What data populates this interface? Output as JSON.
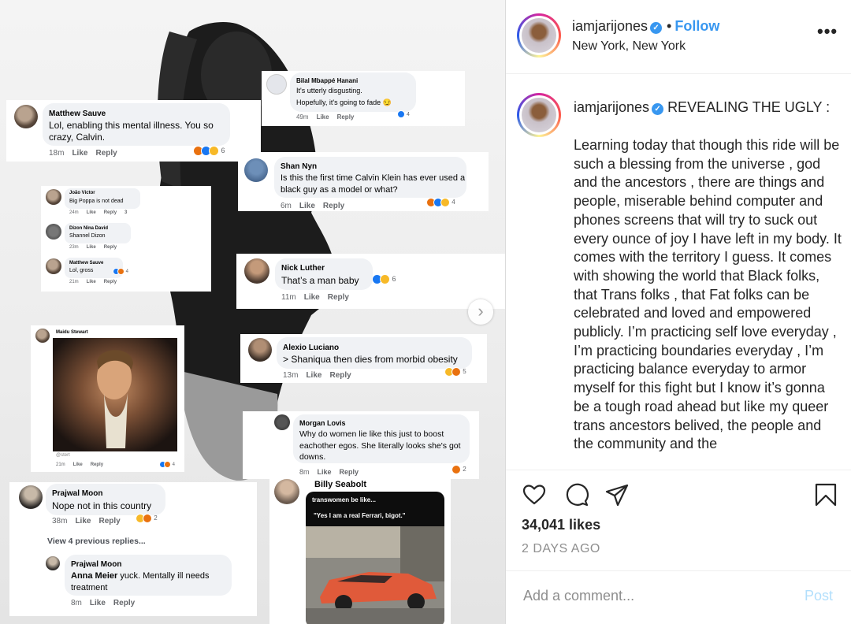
{
  "header": {
    "username": "iamjarijones",
    "follow_label": "Follow",
    "location": "New York, New York",
    "more_label": "•••"
  },
  "caption": {
    "username": "iamjarijones",
    "headline": "REVEALING THE UGLY :",
    "body": "Learning today that though this ride will be such a blessing from the universe , god and the ancestors , there are things and people, miserable behind computer and phones screens that will try to suck out every ounce of joy I have left in my body. It comes with the territory I guess. It comes with showing the world that Black folks, that Trans folks , that Fat folks can be celebrated and loved and empowered publicly. I’m practicing self love everyday , I’m practicing boundaries everyday , I’m practicing balance everyday to armor myself for this fight but I know it’s gonna be a tough road ahead but like my queer trans ancestors belived, the people and the community and the"
  },
  "engagement": {
    "likes": "34,041 likes",
    "time_ago": "2 DAYS AGO"
  },
  "comment_box": {
    "placeholder": "Add a comment...",
    "post_label": "Post"
  },
  "media": {
    "next_label": "›",
    "comments": {
      "bilal": {
        "name": "Bilal Mbappé Hanani",
        "line1": "It's utterly disgusting.",
        "line2": "Hopefully, it's going to fade 😏",
        "time": "49m",
        "like": "Like",
        "reply": "Reply",
        "count": "4"
      },
      "matthew": {
        "name": "Matthew Sauve",
        "text": "Lol, enabling this mental illness. You so crazy, Calvin.",
        "time": "18m",
        "like": "Like",
        "reply": "Reply",
        "count": "6"
      },
      "shan": {
        "name": "Shan Nyn",
        "text": "Is this the first time Calvin Klein has ever used a black guy as a model or what?",
        "time": "6m",
        "like": "Like",
        "reply": "Reply",
        "count": "4"
      },
      "joao": {
        "name": "João Victor",
        "text": "Big Poppa is not dead",
        "time": "24m",
        "like": "Like",
        "reply": "Reply",
        "count": "3"
      },
      "dizon": {
        "name": "Dizon Nina David",
        "text": "Shannel Dizon",
        "time": "23m",
        "like": "Like",
        "reply": "Reply"
      },
      "matthew2": {
        "name": "Matthew Sauve",
        "text": "Lol, gross",
        "time": "21m",
        "like": "Like",
        "reply": "Reply",
        "count": "4"
      },
      "nick": {
        "name": "Nick Luther",
        "text": "That’s a man baby",
        "time": "11m",
        "like": "Like",
        "reply": "Reply",
        "count": "6"
      },
      "maidu": {
        "name": "Maidu Stewart",
        "sub": "@stert",
        "time": "21m",
        "like": "Like",
        "reply": "Reply",
        "count": "4"
      },
      "alexio": {
        "name": "Alexio Luciano",
        "text": "> Shaniqua then dies from morbid obesity",
        "time": "13m",
        "like": "Like",
        "reply": "Reply",
        "count": "5"
      },
      "morgan": {
        "name": "Morgan Lovis",
        "text": "Why do women lie like this just to boost eachother egos. She literally looks she's got downs.",
        "time": "8m",
        "like": "Like",
        "reply": "Reply",
        "count": "2"
      },
      "prajwal": {
        "name": "Prajwal Moon",
        "text": "Nope not in this country",
        "time": "38m",
        "like": "Like",
        "reply": "Reply",
        "count": "2",
        "view_prev": "View 4 previous replies..."
      },
      "prajwal2": {
        "name": "Prajwal Moon",
        "mention": "Anna Meier",
        "text": " yuck. Mentally ill needs treatment",
        "time": "8m",
        "like": "Like",
        "reply": "Reply"
      },
      "billy": {
        "name": "Billy Seabolt",
        "meme_line1": "transwomen be like...",
        "meme_line2": "\"Yes I am a real Ferrari, bigot.\""
      }
    }
  },
  "colors": {
    "accent_blue": "#3897f0",
    "post_disabled": "#b2dffc",
    "muted": "#8e8e8e",
    "text": "#262626"
  }
}
